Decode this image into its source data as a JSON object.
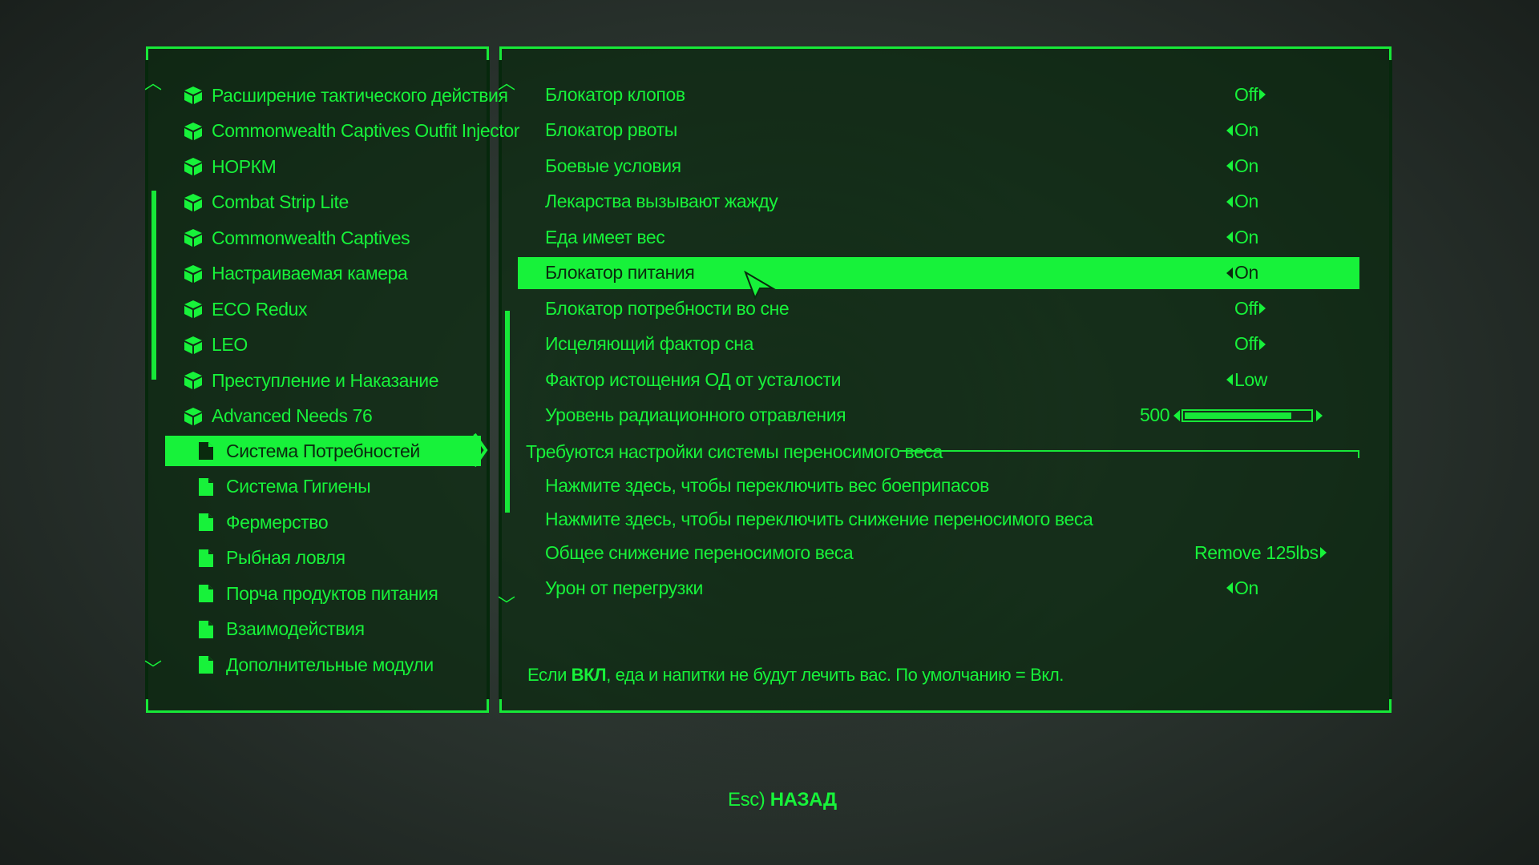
{
  "mods": [
    {
      "label": "Расширение тактического действия",
      "icon": "box-icon"
    },
    {
      "label": "Commonwealth Captives Outfit Injector",
      "icon": "box-icon"
    },
    {
      "label": "НОРКМ",
      "icon": "box-icon"
    },
    {
      "label": "Combat Strip Lite",
      "icon": "box-icon"
    },
    {
      "label": "Commonwealth Captives",
      "icon": "box-icon"
    },
    {
      "label": "Настраиваемая камера",
      "icon": "box-icon"
    },
    {
      "label": "ECO Redux",
      "icon": "box-icon"
    },
    {
      "label": "LEO",
      "icon": "box-icon"
    },
    {
      "label": "Преступление и Наказание",
      "icon": "box-icon"
    },
    {
      "label": "Advanced Needs 76",
      "icon": "box-icon"
    }
  ],
  "pages": [
    {
      "label": "Система Потребностей",
      "selected": true
    },
    {
      "label": "Система Гигиены"
    },
    {
      "label": "Фермерство"
    },
    {
      "label": "Рыбная ловля"
    },
    {
      "label": "Порча продуктов питания"
    },
    {
      "label": "Взаимодействия"
    },
    {
      "label": "Дополнительные модули"
    }
  ],
  "options": [
    {
      "label": "Блокатор клопов",
      "value": "Off"
    },
    {
      "label": "Блокатор рвоты",
      "value": "On"
    },
    {
      "label": "Боевые условия",
      "value": "On"
    },
    {
      "label": "Лекарства вызывают жажду",
      "value": "On"
    },
    {
      "label": "Еда имеет вес",
      "value": "On"
    },
    {
      "label": "Блокатор питания",
      "value": "On",
      "selected": true
    },
    {
      "label": "Блокатор потребности во сне",
      "value": "Off"
    },
    {
      "label": "Исцеляющий фактор сна",
      "value": "Off"
    },
    {
      "label": "Фактор истощения ОД от усталости",
      "value": "Low"
    },
    {
      "label": "Уровень радиационного отравления",
      "value": "500",
      "slider_fraction": 0.85
    }
  ],
  "section": {
    "title": "Требуются настройки системы переносимого веса"
  },
  "options2": [
    {
      "label": "Нажмите здесь, чтобы переключить вес боеприпасов"
    },
    {
      "label": "Нажмите здесь, чтобы переключить снижение переносимого веса"
    },
    {
      "label": "Общее снижение переносимого веса",
      "value": "Remove 125lbs"
    },
    {
      "label": "Урон от перегрузки",
      "value": "On"
    }
  ],
  "description": {
    "prefix": "Если ",
    "bold": "ВКЛ",
    "suffix": ", еда и напитки не будут лечить вас. По умолчанию = Вкл."
  },
  "footer": {
    "key": "Esc)",
    "label": "НАЗАД"
  },
  "colors": {
    "accent": "#17f23a",
    "dark_text": "#0a2a0e"
  }
}
